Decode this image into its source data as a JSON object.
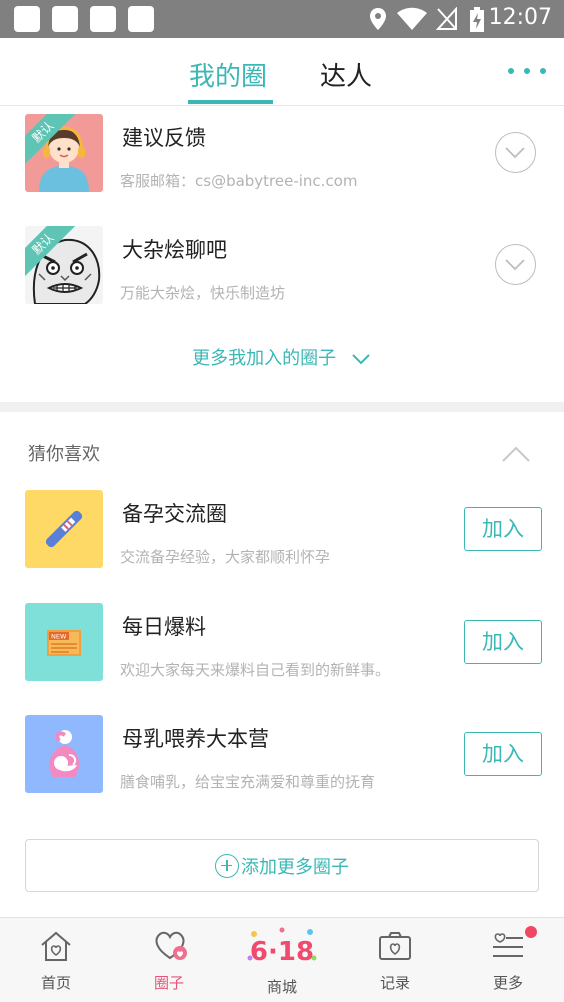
{
  "status_bar": {
    "time": "12:07"
  },
  "header": {
    "tabs": [
      {
        "label": "我的圈",
        "active": true
      },
      {
        "label": "达人",
        "active": false
      }
    ],
    "accent_color": "#3bb8b6"
  },
  "my_circles": [
    {
      "badge": "默认",
      "title": "建议反馈",
      "subtitle": "客服邮箱：cs@babytree-inc.com",
      "thumb_icon": "headset-avatar-icon"
    },
    {
      "badge": "默认",
      "title": "大杂烩聊吧",
      "subtitle": "万能大杂烩，快乐制造坊",
      "thumb_icon": "meme-face-icon"
    }
  ],
  "more_joined_label": "更多我加入的圈子",
  "recommend": {
    "title": "猜你喜欢",
    "items": [
      {
        "title": "备孕交流圈",
        "subtitle": "交流备孕经验，大家都顺利怀孕",
        "join_label": "加入",
        "thumb_color": "#ffd966",
        "thumb_icon": "pregnancy-test-icon"
      },
      {
        "title": "每日爆料",
        "subtitle": "欢迎大家每天来爆料自己看到的新鲜事。",
        "join_label": "加入",
        "thumb_color": "#7fe0d9",
        "thumb_icon": "news-icon",
        "news_tag": "NEW"
      },
      {
        "title": "母乳喂养大本营",
        "subtitle": "膳食哺乳，给宝宝充满爱和尊重的抚育",
        "join_label": "加入",
        "thumb_color": "#8fb8ff",
        "thumb_icon": "breastfeeding-icon"
      }
    ]
  },
  "add_more_label": "添加更多圈子",
  "bottom_nav": [
    {
      "label": "首页",
      "icon": "home-icon",
      "active": false
    },
    {
      "label": "圈子",
      "icon": "circle-heart-icon",
      "active": true
    },
    {
      "label": "商城",
      "icon": "618-mall-icon",
      "active": false,
      "logo_text": "6·18"
    },
    {
      "label": "记录",
      "icon": "camera-icon",
      "active": false
    },
    {
      "label": "更多",
      "icon": "more-menu-icon",
      "active": false
    }
  ]
}
